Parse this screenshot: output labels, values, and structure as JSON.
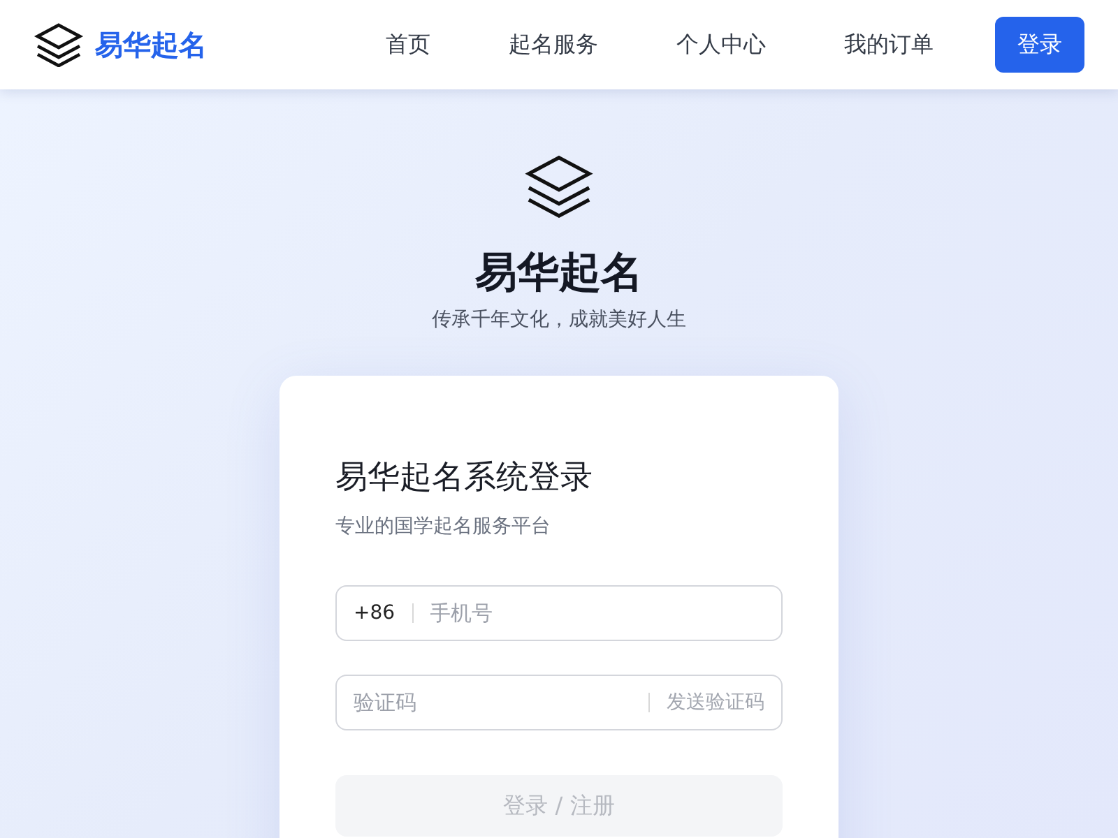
{
  "header": {
    "brand": "易华起名",
    "nav": [
      {
        "label": "首页",
        "selected": false
      },
      {
        "label": "起名服务",
        "selected": false
      },
      {
        "label": "个人中心",
        "selected": false
      },
      {
        "label": "我的订单",
        "selected": false
      }
    ],
    "login_button": "登录"
  },
  "hero": {
    "title": "易华起名",
    "slogan": "传承千年文化，成就美好人生"
  },
  "login_card": {
    "title": "易华起名系统登录",
    "subtitle": "专业的国学起名服务平台",
    "phone_field": {
      "prefix": "+86",
      "placeholder": "手机号"
    },
    "code_field": {
      "placeholder": "验证码",
      "send_button": "发送验证码"
    },
    "submit": {
      "label": "登录 / 注册",
      "disabled": true
    }
  }
}
